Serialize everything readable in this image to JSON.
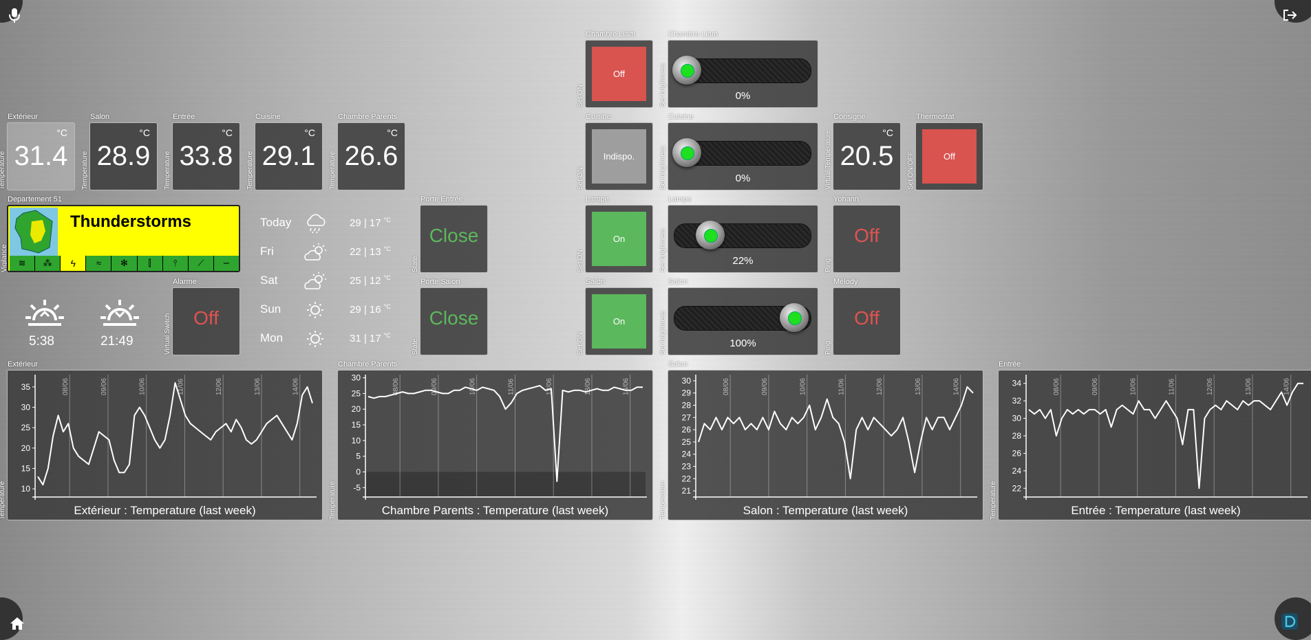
{
  "corners": {
    "mic": "microphone-icon",
    "logout": "logout-icon",
    "home": "home-icon",
    "domoticz": "domoticz-logo-icon"
  },
  "temps": [
    {
      "label": "Extérieur",
      "side": "Temperature",
      "value": "31.4",
      "unit": "°C"
    },
    {
      "label": "Salon",
      "side": "Temperature",
      "value": "28.9",
      "unit": "°C"
    },
    {
      "label": "Entrée",
      "side": "Temperature",
      "value": "33.8",
      "unit": "°C"
    },
    {
      "label": "Cuisine",
      "side": "Temperature",
      "value": "29.1",
      "unit": "°C"
    },
    {
      "label": "Chambre Parents",
      "side": "Temperature",
      "value": "26.6",
      "unit": "°C"
    }
  ],
  "vigilance": {
    "label": "Departement 51",
    "side": "Vigilance",
    "title": "Thunderstorms",
    "bg": "#ffff00"
  },
  "sun": {
    "rise": "5:38",
    "set": "21:49"
  },
  "alarme": {
    "label": "Alarme",
    "side": "Virtual Switch",
    "value": "Off"
  },
  "forecast": [
    {
      "day": "Today",
      "icon": "rain-cloud-icon",
      "temp": "29 | 17",
      "unit": "°C"
    },
    {
      "day": "Fri",
      "icon": "partly-sunny-icon",
      "temp": "22 | 13",
      "unit": "°C"
    },
    {
      "day": "Sat",
      "icon": "partly-sunny-icon",
      "temp": "25 | 12",
      "unit": "°C"
    },
    {
      "day": "Sun",
      "icon": "sun-icon",
      "temp": "29 | 16",
      "unit": "°C"
    },
    {
      "day": "Mon",
      "icon": "sun-icon",
      "temp": "31 | 17",
      "unit": "°C"
    }
  ],
  "doors": [
    {
      "label": "Porte Entrée",
      "side": "State",
      "value": "Close"
    },
    {
      "label": "Porte Salon",
      "side": "State",
      "value": "Close"
    }
  ],
  "switches": [
    {
      "label": "Chambre Liam",
      "side": "Set ON",
      "value": "Off",
      "color": "#d9534f"
    },
    {
      "label": "Cuisine",
      "side": "Set ON",
      "value": "Indispo.",
      "color": "#9e9e9e"
    },
    {
      "label": "Lampe",
      "side": "Set ON",
      "value": "On",
      "color": "#5cb85c"
    },
    {
      "label": "Salon",
      "side": "Set ON",
      "value": "On",
      "color": "#5cb85c"
    }
  ],
  "dimmers": [
    {
      "label": "Chambre Liam",
      "side": "Set brightness",
      "value": "0%",
      "level": 0
    },
    {
      "label": "Cuisine",
      "side": "Set brightness",
      "value": "0%",
      "level": 0
    },
    {
      "label": "Lampe",
      "side": "Set brightness",
      "value": "22%",
      "level": 22
    },
    {
      "label": "Salon",
      "side": "Set brightness",
      "value": "100%",
      "level": 100
    }
  ],
  "consigne": {
    "label": "Consigne",
    "side": "Virtual Temperature",
    "value": "20.5",
    "unit": "°C"
  },
  "thermostat": {
    "label": "Thermostat",
    "side": "Set ON/OFF",
    "value": "Off",
    "color": "#d9534f"
  },
  "pings": [
    {
      "label": "Yohann",
      "side": "Ping",
      "value": "Off"
    },
    {
      "label": "Melody",
      "side": "Ping",
      "value": "Off"
    }
  ],
  "chart_data": [
    {
      "type": "line",
      "label": "Extérieur",
      "ylabel": "Temperature",
      "title": "Extérieur : Temperature (last week)",
      "x_ticks": [
        "08/06",
        "09/06",
        "10/06",
        "11/06",
        "12/06",
        "13/06",
        "14/06"
      ],
      "y_ticks": [
        10,
        15,
        20,
        25,
        30,
        35
      ],
      "ylim": [
        8,
        38
      ],
      "values": [
        13,
        11,
        15,
        23,
        28,
        24,
        26,
        20,
        18,
        17,
        16,
        20,
        24,
        23,
        22,
        17,
        14,
        14,
        16,
        28,
        30,
        28,
        25,
        22,
        20,
        22,
        28,
        36,
        32,
        28,
        26,
        25,
        24,
        23,
        22,
        24,
        25,
        26,
        24,
        27,
        25,
        22,
        21,
        22,
        24,
        26,
        27,
        28,
        26,
        24,
        22,
        26,
        33,
        35,
        31
      ]
    },
    {
      "type": "line",
      "label": "Chambre Parents",
      "ylabel": "Temperature",
      "title": "Chambre Parents : Temperature (last week)",
      "x_ticks": [
        "08/06",
        "09/06",
        "10/06",
        "11/06",
        "12/06",
        "13/06",
        "14/06"
      ],
      "y_ticks": [
        -5,
        0,
        5,
        10,
        15,
        20,
        25,
        30
      ],
      "ylim": [
        -8,
        31
      ],
      "values": [
        24,
        23.5,
        24,
        24,
        24.5,
        25,
        25.5,
        25,
        25,
        25.5,
        26,
        26,
        25.5,
        25,
        25,
        26,
        26,
        27,
        26.5,
        26,
        27,
        26.5,
        26,
        24,
        20,
        22,
        25,
        26,
        26.5,
        27,
        27.5,
        26,
        26.5,
        -3,
        26,
        25.5,
        26,
        26,
        25.5,
        26,
        26.5,
        26,
        26,
        27,
        26.5,
        26,
        26,
        27,
        27
      ]
    },
    {
      "type": "line",
      "label": "Salon",
      "ylabel": "Temperature",
      "title": "Salon : Temperature (last week)",
      "x_ticks": [
        "08/06",
        "09/06",
        "10/06",
        "11/06",
        "12/06",
        "13/06",
        "14/06"
      ],
      "y_ticks": [
        21,
        22,
        23,
        24,
        25,
        26,
        27,
        28,
        29,
        30
      ],
      "ylim": [
        20.5,
        30.5
      ],
      "values": [
        25,
        26.5,
        26,
        27,
        26,
        27,
        26.5,
        27,
        26,
        26.5,
        26,
        27,
        26,
        27.5,
        26.5,
        26,
        27,
        26.5,
        27,
        28,
        26,
        27,
        28.5,
        27,
        26.5,
        25,
        22,
        26,
        27,
        26,
        27,
        26.5,
        26,
        25.5,
        26,
        27,
        25,
        22.5,
        25,
        27,
        26,
        27,
        27,
        26,
        27,
        28,
        29.5,
        29
      ]
    },
    {
      "type": "line",
      "label": "Entrée",
      "ylabel": "Temperature",
      "title": "Entrée : Temperature (last week)",
      "x_ticks": [
        "08/06",
        "09/06",
        "10/06",
        "11/06",
        "12/06",
        "13/06",
        "14/06"
      ],
      "y_ticks": [
        22,
        24,
        26,
        28,
        30,
        32,
        34
      ],
      "ylim": [
        21,
        35
      ],
      "values": [
        31,
        30.5,
        31,
        30,
        31,
        28,
        30,
        31,
        30.5,
        31,
        30.5,
        31,
        31,
        30.5,
        31,
        29,
        31,
        31.5,
        31,
        30.5,
        32,
        31,
        31,
        30,
        31,
        32,
        31,
        30,
        27,
        31,
        31,
        22,
        30,
        31,
        31.5,
        31,
        32,
        31.5,
        31,
        32,
        31.5,
        32,
        32,
        31.5,
        31,
        32,
        33,
        31.5,
        33,
        34,
        34
      ]
    }
  ]
}
